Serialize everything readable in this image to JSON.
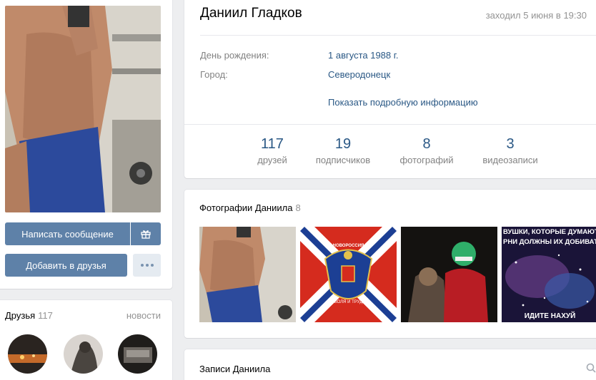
{
  "profile": {
    "name": "Даниил Гладков",
    "last_seen": "заходил 5 июня в 19:30",
    "info": [
      {
        "label": "День рождения:",
        "value": "1 августа 1988 г."
      },
      {
        "label": "Город:",
        "value": "Северодонецк"
      }
    ],
    "more_info": "Показать подробную информацию",
    "counters": [
      {
        "num": "117",
        "label": "друзей"
      },
      {
        "num": "19",
        "label": "подписчиков"
      },
      {
        "num": "8",
        "label": "фотографий"
      },
      {
        "num": "3",
        "label": "видеозаписи"
      }
    ]
  },
  "actions": {
    "message": "Написать сообщение",
    "add_friend": "Добавить в друзья",
    "gift_icon": "gift-icon",
    "more_icon": "more-dots-icon"
  },
  "friends": {
    "title": "Друзья",
    "count": "117",
    "news": "новости"
  },
  "photos": {
    "title": "Фотографии Даниила",
    "count": "8",
    "flag_text_top": "НОВОРОССИЯ",
    "flag_text_bottom": "ВОЛЯ И ТРУД",
    "meme_top_1": "ВУШКИ, КОТОРЫЕ ДУМАЮТ, ",
    "meme_top_2": "РНИ ДОЛЖНЫ ИХ ДОБИВАТЬ",
    "meme_bottom": "ИДИТЕ НАХУЙ"
  },
  "posts": {
    "title": "Записи Даниила",
    "search_icon": "search-icon"
  },
  "colors": {
    "link": "#2a5885",
    "button": "#5e81a8",
    "muted": "#828282",
    "flag_red": "#d52b1e",
    "flag_blue": "#1c3f94"
  }
}
